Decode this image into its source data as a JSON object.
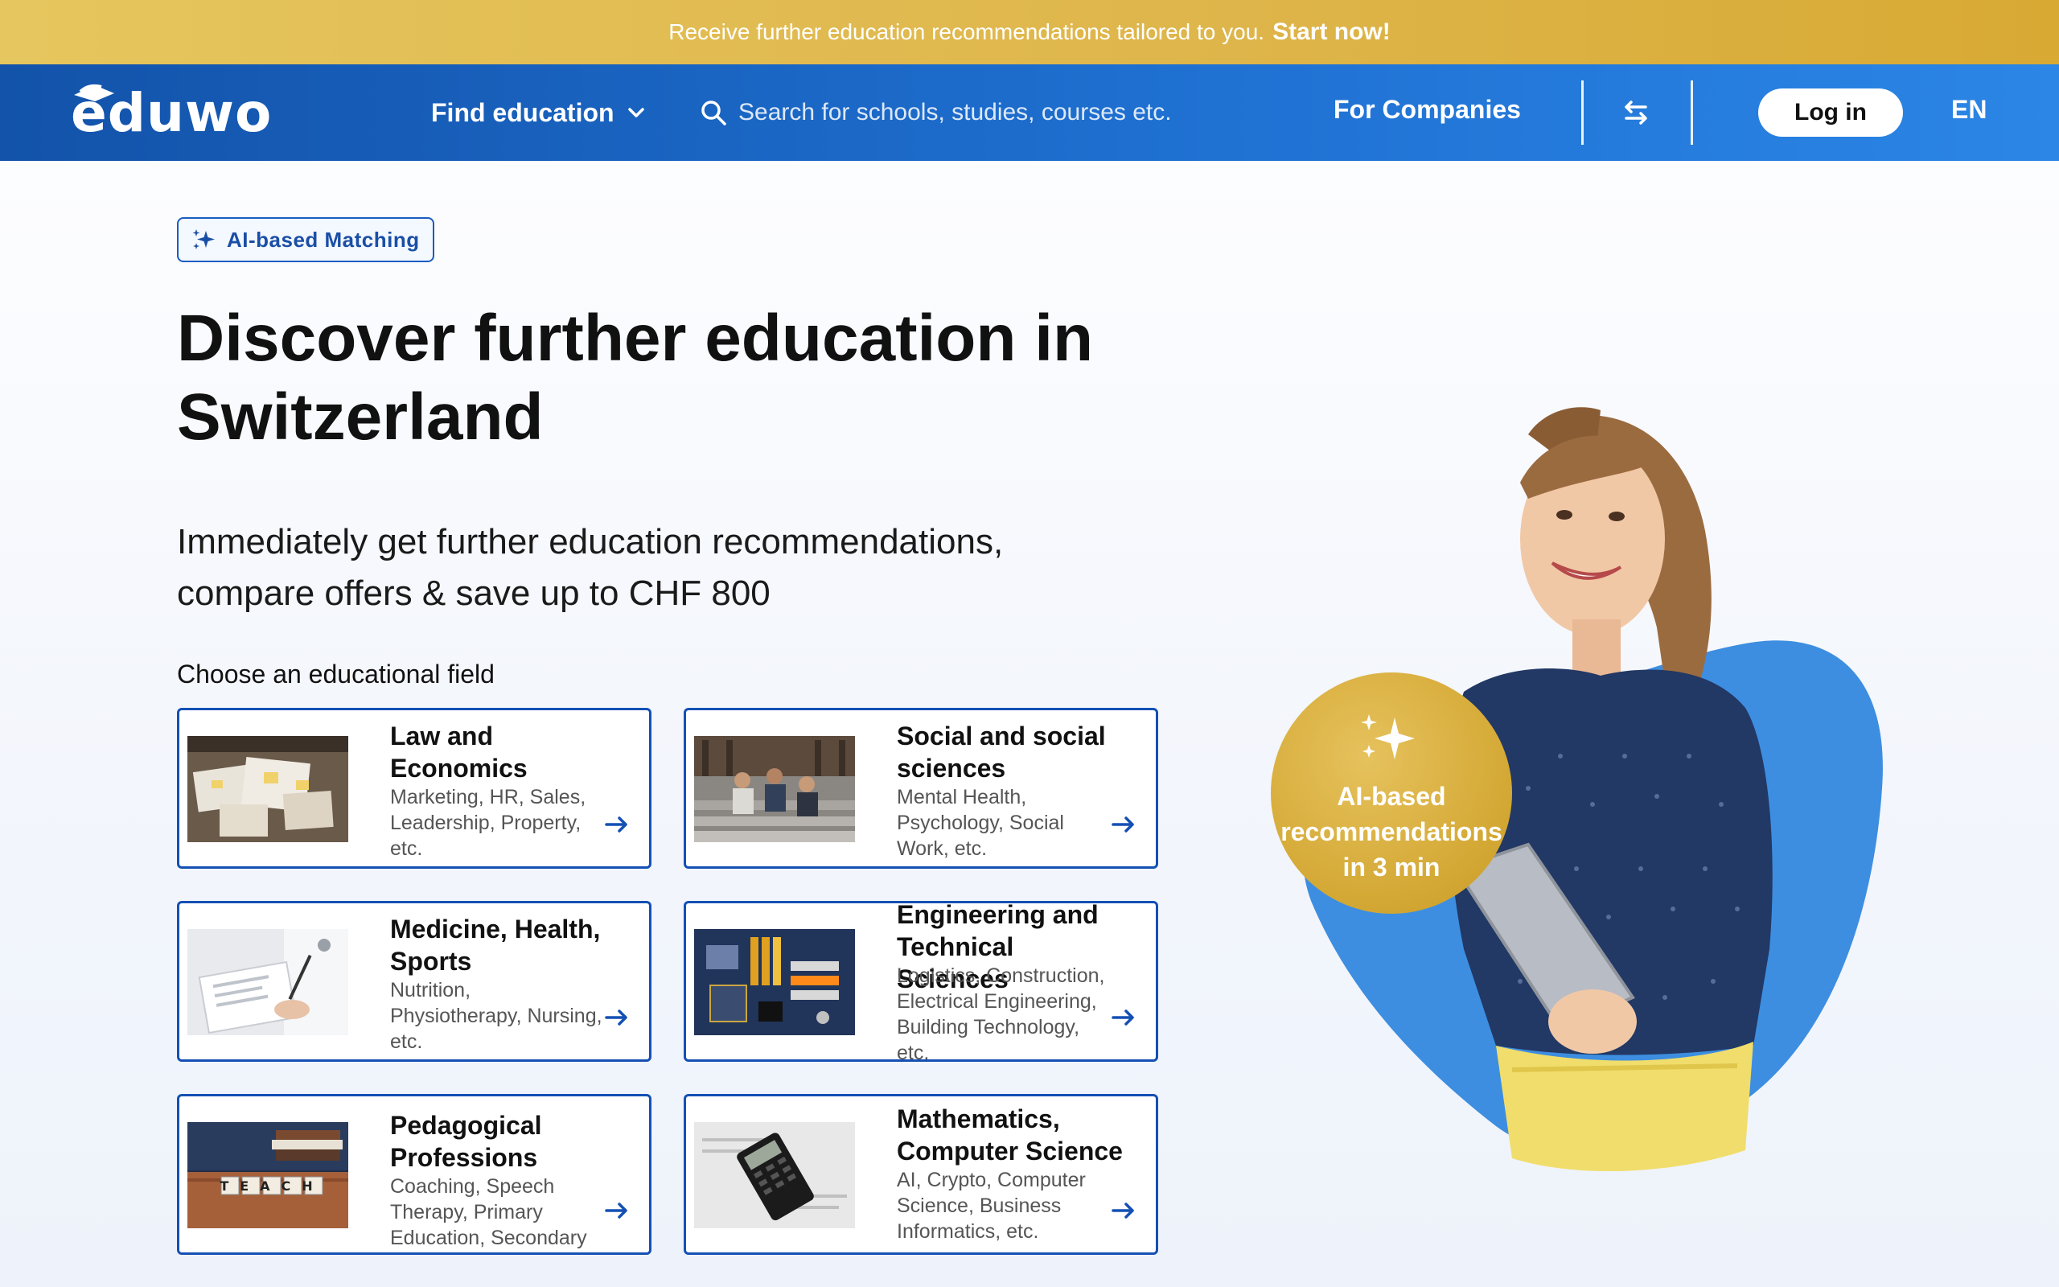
{
  "banner": {
    "text": "Receive further education recommendations tailored to you.",
    "cta": "Start now!"
  },
  "nav": {
    "logo": "eduwo",
    "find_education": "Find education",
    "search_placeholder": "Search for schools, studies, courses etc.",
    "for_companies": "For Companies",
    "login": "Log in",
    "language": "EN"
  },
  "hero": {
    "badge": "AI-based Matching",
    "title": "Discover further education in Switzerland",
    "subtitle": "Immediately get further education recommendations, compare offers & save up to CHF 800",
    "field_label": "Choose an educational field"
  },
  "fields": [
    {
      "title": "Law and Economics",
      "desc": "Marketing, HR, Sales, Leadership, Property, etc.",
      "image": "documents-photo"
    },
    {
      "title": "Social and social sciences",
      "desc": "Mental Health, Psychology, Social Work, etc.",
      "image": "students-on-stairs-photo"
    },
    {
      "title": "Medicine, Health, Sports",
      "desc": "Nutrition, Physiotherapy, Nursing, etc.",
      "image": "doctor-clipboard-photo"
    },
    {
      "title": "Engineering and Technical Sciences",
      "desc": "Logistics, Construction, Electrical Engineering, Building Technology, etc.",
      "image": "circuit-board-photo"
    },
    {
      "title": "Pedagogical Professions",
      "desc": "Coaching, Speech Therapy, Primary Education, Secondary",
      "image": "teach-blocks-photo",
      "image_text": "TEACH"
    },
    {
      "title": "Mathematics, Computer Science",
      "desc": "AI, Crypto, Computer Science, Business Informatics, etc.",
      "image": "calculator-photo"
    }
  ],
  "promo_circle": {
    "text": "AI-based recommendations in 3 min"
  },
  "colors": {
    "brand_blue": "#1a5cc0",
    "banner_gold": "#deb54a",
    "accent_blob": "#3d8ee0"
  }
}
